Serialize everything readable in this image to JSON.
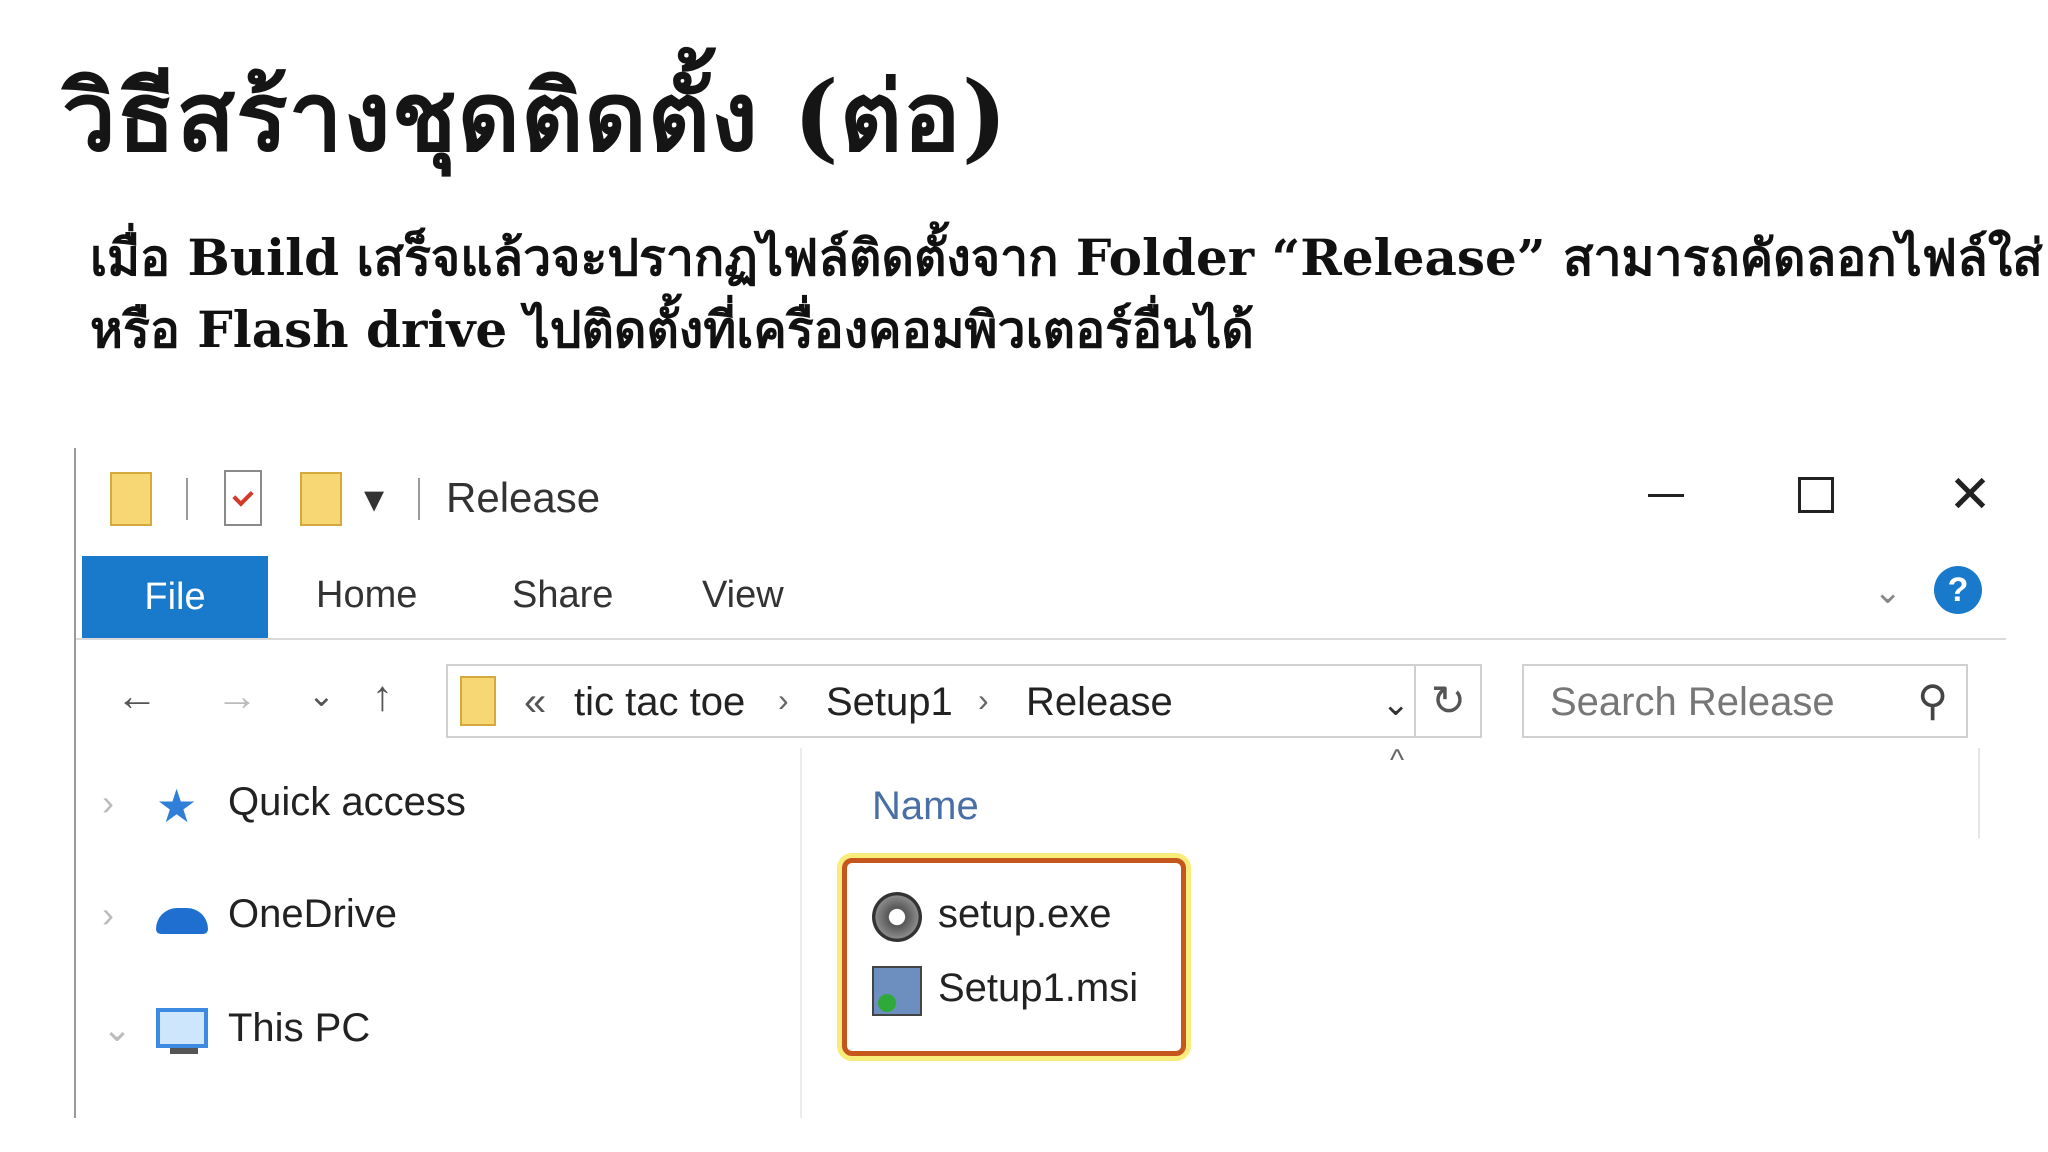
{
  "slide": {
    "title": "วิธีสร้างชุดติดตั้ง (ต่อ)",
    "subtitle_line1": "เมื่อ Build เสร็จแล้วจะปรากฏไฟล์ติดตั้งจาก Folder “Release” สามารถคัดลอกไฟล์ใส่ CD",
    "subtitle_line2": "หรือ Flash drive ไปติดตั้งที่เครื่องคอมพิวเตอร์อื่นได้"
  },
  "explorer": {
    "window_title": "Release",
    "controls": {
      "minimize": "—",
      "close": "✕"
    },
    "ribbon_tabs": [
      "File",
      "Home",
      "Share",
      "View"
    ],
    "help": "?",
    "nav": {
      "back": "←",
      "forward": "→",
      "recent": "⌄",
      "up": "↑"
    },
    "address": {
      "overflow": "«",
      "crumbs": [
        "tic tac toe",
        "Setup1",
        "Release"
      ],
      "separator": "›",
      "dropdown": "⌄",
      "refresh": "↻"
    },
    "search": {
      "placeholder": "Search Release",
      "icon": "⚲"
    },
    "nav_pane": [
      {
        "label": "Quick access",
        "icon": "quick-access-star-icon",
        "expander": "›"
      },
      {
        "label": "OneDrive",
        "icon": "onedrive-cloud-icon",
        "expander": "›"
      },
      {
        "label": "This PC",
        "icon": "this-pc-monitor-icon",
        "expander": "⌄"
      }
    ],
    "column_header": "Name",
    "sort_indicator": "^",
    "files": [
      {
        "name": "setup.exe",
        "icon": "setup-exe-icon"
      },
      {
        "name": "Setup1.msi",
        "icon": "msi-installer-icon"
      }
    ],
    "colors": {
      "file_tab": "#1979ca",
      "highlight_border": "#c5571c",
      "highlight_glow": "#f8ec7a"
    }
  }
}
